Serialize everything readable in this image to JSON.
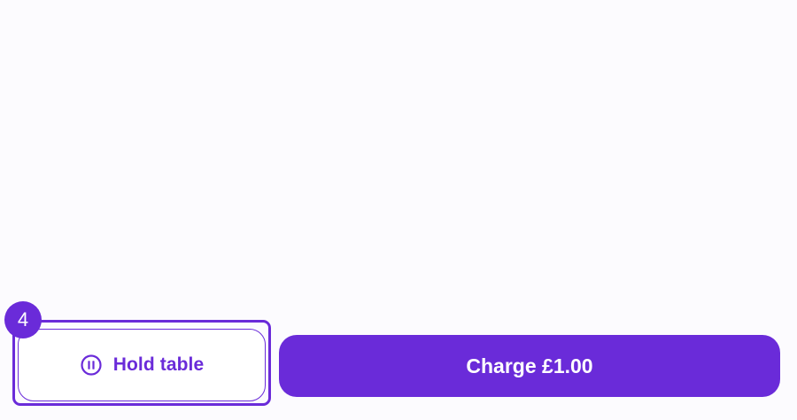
{
  "footer": {
    "hold_button": {
      "label": "Hold table",
      "icon": "pause-circle-icon",
      "badge": "4"
    },
    "charge_button": {
      "label": "Charge £1.00"
    }
  },
  "colors": {
    "accent": "#6a2bd9",
    "background": "#fcfbfe",
    "button_text_on_accent": "#ffffff"
  }
}
